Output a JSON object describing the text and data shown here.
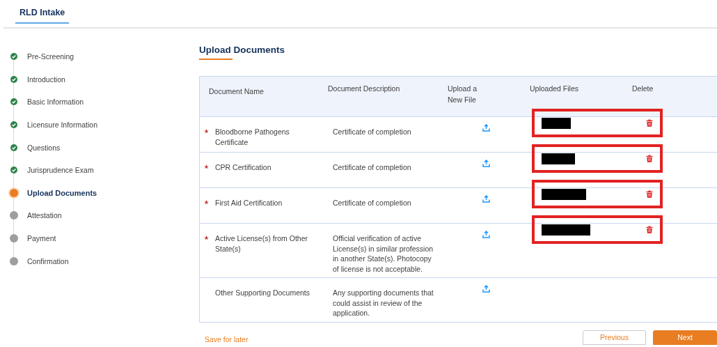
{
  "header": {
    "tab": {
      "label": "RLD Intake",
      "selected": true
    }
  },
  "steps": [
    {
      "label": "Pre-Screening",
      "kind": "complete"
    },
    {
      "label": "Introduction",
      "kind": "complete"
    },
    {
      "label": "Basic Information",
      "kind": "complete"
    },
    {
      "label": "Licensure Information",
      "kind": "complete"
    },
    {
      "label": "Questions",
      "kind": "complete"
    },
    {
      "label": "Jurisprudence Exam",
      "kind": "complete"
    },
    {
      "label": "Upload Documents",
      "kind": "current"
    },
    {
      "label": "Attestation",
      "kind": "upcoming"
    },
    {
      "label": "Payment",
      "kind": "upcoming"
    },
    {
      "label": "Confirmation",
      "kind": "upcoming"
    }
  ],
  "section": {
    "title": "Upload Documents"
  },
  "table": {
    "columns": [
      "Document Name",
      "Document Description",
      "Upload a New File",
      "Uploaded Files",
      "Delete"
    ],
    "rows": [
      {
        "name": "Bloodborne Pathogens Certificate",
        "required": true,
        "description": "Certificate of completion",
        "has_file": true
      },
      {
        "name": "CPR Certification",
        "required": true,
        "description": "Certificate of completion",
        "has_file": true
      },
      {
        "name": "First Aid Certification",
        "required": true,
        "description": "Certificate of completion",
        "has_file": true
      },
      {
        "name": "Active License(s) from Other State(s)",
        "required": true,
        "description": "Official verification of active License(s) in similar profession in another State(s). Photocopy of license is not acceptable.",
        "has_file": true
      },
      {
        "name": "Other Supporting Documents",
        "required": false,
        "description": "Any supporting documents that could assist in review of the application.",
        "has_file": false
      }
    ]
  },
  "footer": {
    "save_link": "Save for later",
    "buttons": [
      "Previous",
      "Next"
    ]
  }
}
